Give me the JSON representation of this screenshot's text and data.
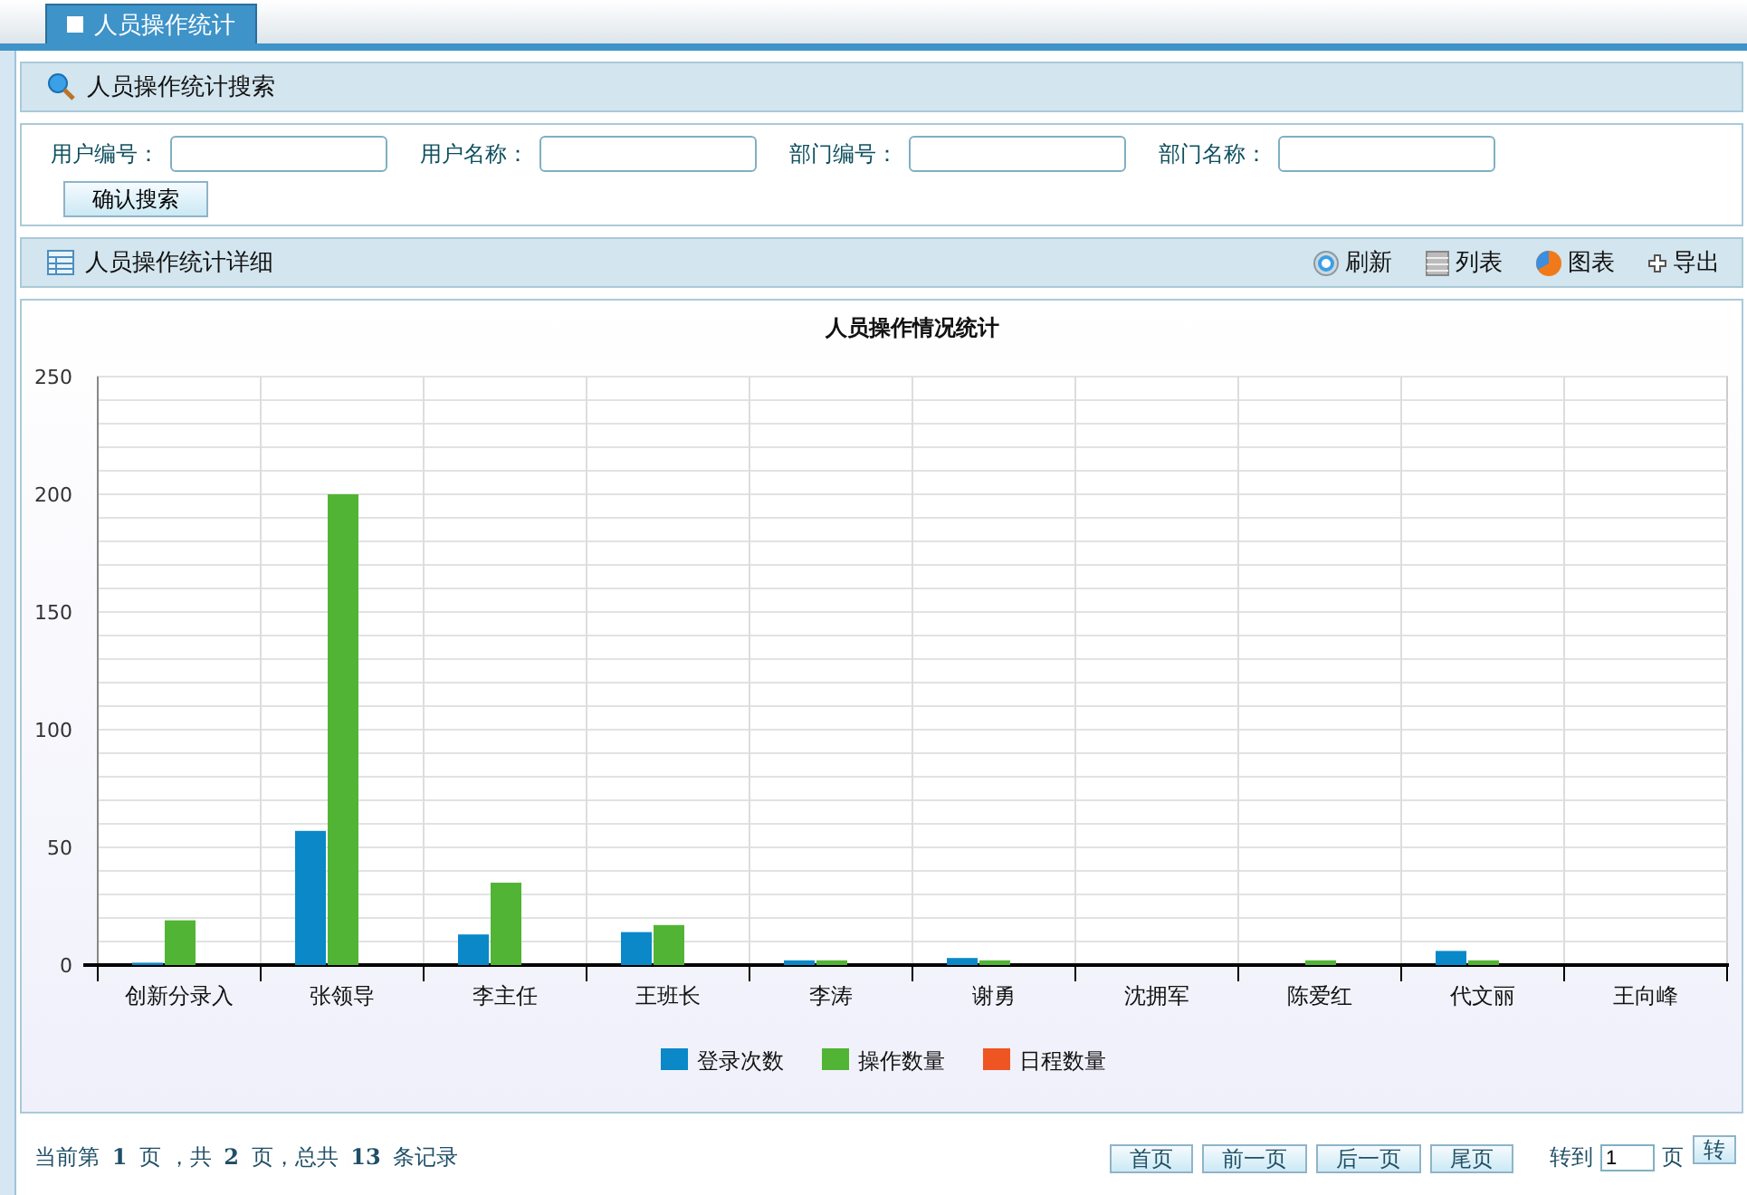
{
  "tabs": [
    {
      "label": "人员操作统计",
      "selected": true
    }
  ],
  "search_panel": {
    "title": "人员操作统计搜索",
    "fields": [
      {
        "label": "用户编号："
      },
      {
        "label": "用户名称："
      },
      {
        "label": "部门编号："
      },
      {
        "label": "部门名称："
      }
    ],
    "submit": "确认搜索"
  },
  "detail_panel": {
    "title": "人员操作统计详细",
    "actions": [
      {
        "kind": "refresh",
        "label": "刷新"
      },
      {
        "kind": "list",
        "label": "列表"
      },
      {
        "kind": "chart",
        "label": "图表"
      },
      {
        "kind": "export",
        "label": "导出"
      }
    ]
  },
  "chart": {
    "chart_data": {
      "type": "bar",
      "title": "人员操作情况统计",
      "categories": [
        "创新分录入",
        "张领导",
        "李主任",
        "王班长",
        "李涛",
        "谢勇",
        "沈拥军",
        "陈爱红",
        "代文丽",
        "王向峰"
      ],
      "series": [
        {
          "name": "登录次数",
          "color": "#0a88c8",
          "values": [
            1,
            57,
            13,
            14,
            2,
            3,
            0,
            0,
            6,
            0
          ]
        },
        {
          "name": "操作数量",
          "color": "#52b435",
          "values": [
            19,
            200,
            35,
            17,
            2,
            2,
            0,
            2,
            2,
            0
          ]
        },
        {
          "name": "日程数量",
          "color": "#ee5522",
          "values": [
            0,
            0,
            0,
            0,
            0,
            0,
            0,
            0,
            0,
            0
          ]
        }
      ],
      "grid": true,
      "legend": true,
      "ylim": [
        0,
        250
      ],
      "yticks": [
        0,
        50,
        100,
        150,
        200,
        250
      ]
    }
  },
  "pager": {
    "summary": "当前第 **1** 页 ，共 **2** 页，总共 **13** 条记录",
    "buttons": [
      "首页",
      "前一页",
      "后一页",
      "尾页"
    ],
    "goto_label": "转到",
    "page_value": "1",
    "page_unit": "页",
    "go_button": "转"
  }
}
